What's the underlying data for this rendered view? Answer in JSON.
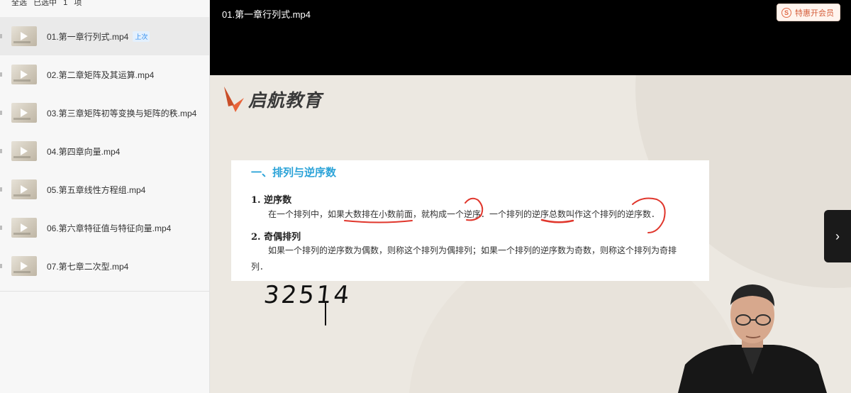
{
  "sidebar": {
    "select_all": "全选",
    "selected_prefix": "已选中",
    "selected_count": "1",
    "selected_suffix": "项",
    "items": [
      {
        "label": "01.第一章行列式.mp4",
        "badge": "上次"
      },
      {
        "label": "02.第二章矩阵及其运算.mp4"
      },
      {
        "label": "03.第三章矩阵初等变换与矩阵的秩.mp4"
      },
      {
        "label": "04.第四章向量.mp4"
      },
      {
        "label": "05.第五章线性方程组.mp4"
      },
      {
        "label": "06.第六章特征值与特征向量.mp4"
      },
      {
        "label": "07.第七章二次型.mp4"
      }
    ]
  },
  "player": {
    "title": "01.第一章行列式.mp4",
    "vip_label": "特惠开会员",
    "vip_icon": "S"
  },
  "slide": {
    "logo_text": "启航教育",
    "heading": "一、排列与逆序数",
    "section1_title": "1. 逆序数",
    "section1_text": "在一个排列中，如果大数排在小数前面，就构成一个逆序．一个排列的逆序总数叫作这个排列的逆序数．",
    "section2_title": "2. 奇偶排列",
    "section2_text": "如果一个排列的逆序数为偶数，则称这个排列为偶排列；如果一个排列的逆序数为奇数，则称这个排列为奇排列．",
    "handwritten": "32514"
  },
  "colors": {
    "accent": "#2ba3d8",
    "logo_orange": "#e8643a",
    "ink_red": "#e0362c",
    "vip_text": "#d55d3a"
  }
}
